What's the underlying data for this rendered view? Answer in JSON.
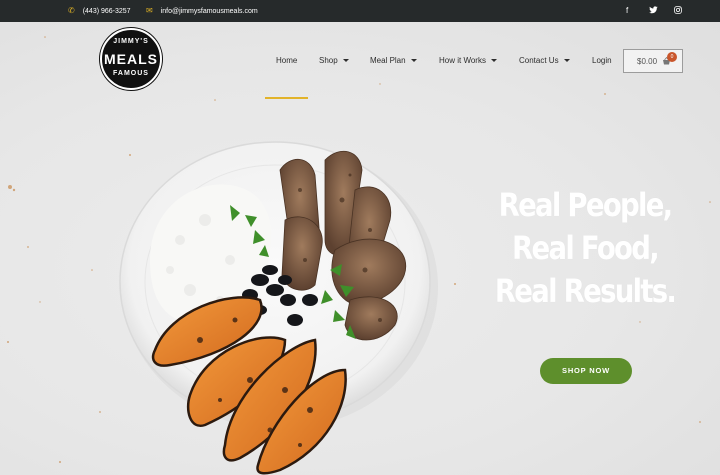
{
  "topbar": {
    "phone_icon": "phone-icon",
    "phone": "(443) 966-3257",
    "email_icon": "envelope-icon",
    "email": "info@jimmysfamousmeals.com",
    "social": [
      {
        "icon": "facebook-icon",
        "glyph": "f"
      },
      {
        "icon": "twitter-icon",
        "glyph": "🐦"
      },
      {
        "icon": "instagram-icon",
        "glyph": "◎"
      }
    ]
  },
  "logo": {
    "top": "JIMMY'S",
    "middle": "MEALS",
    "bottom": "FAMOUS"
  },
  "nav": {
    "items": [
      {
        "label": "Home",
        "dropdown": false
      },
      {
        "label": "Shop",
        "dropdown": true
      },
      {
        "label": "Meal Plan",
        "dropdown": true
      },
      {
        "label": "How it Works",
        "dropdown": true
      },
      {
        "label": "Contact Us",
        "dropdown": true
      },
      {
        "label": "Login",
        "dropdown": false
      }
    ],
    "active_index": 0,
    "cart": {
      "total": "$0.00",
      "count": "0",
      "icon": "basket-icon"
    }
  },
  "hero": {
    "headline": [
      "Real People,",
      "Real Food,",
      "Real Results."
    ],
    "cta": "SHOP NOW"
  },
  "colors": {
    "topbar_bg": "#262a2b",
    "accent_yellow": "#e2b32a",
    "cta_green": "#5e8f2c",
    "cart_badge": "#c9562b"
  }
}
